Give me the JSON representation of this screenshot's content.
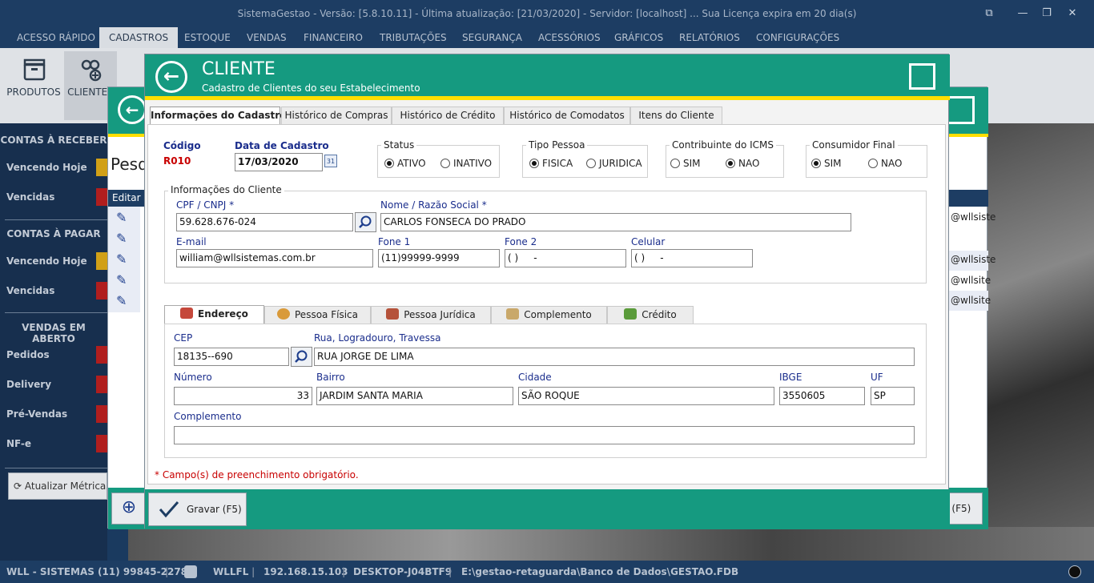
{
  "window": {
    "title": "SistemaGestao - Versão: [5.8.10.11] - Última atualização: [21/03/2020] - Servidor: [localhost] ... Sua Licença expira em 20 dia(s)"
  },
  "menu": [
    "ACESSO RÁPIDO",
    "CADASTROS",
    "ESTOQUE",
    "VENDAS",
    "FINANCEIRO",
    "TRIBUTAÇÕES",
    "SEGURANÇA",
    "ACESSÓRIOS",
    "GRÁFICOS",
    "RELATÓRIOS",
    "CONFIGURAÇÕES"
  ],
  "ribbon": {
    "produtos": "PRODUTOS",
    "clientes": "CLIENTES"
  },
  "sidebar": {
    "contas_receber": "CONTAS À RECEBER",
    "vencendo_hoje_1": "Vencendo Hoje",
    "vencidas_1": "Vencidas",
    "contas_pagar": "CONTAS À PAGAR",
    "vencendo_hoje_2": "Vencendo Hoje",
    "vencidas_2": "Vencidas",
    "vendas_aberto": "VENDAS EM ABERTO",
    "pedidos": "Pedidos",
    "delivery": "Delivery",
    "pre_vendas": "Pré-Vendas",
    "nfe": "NF-e",
    "atualizar": "Atualizar Métricas"
  },
  "behind": {
    "pesq": "Pesq",
    "editar": "Editar",
    "emails": [
      "@wllsiste",
      "@wllsiste",
      "@wllsite",
      "@wllsite"
    ],
    "f5": "r (F5)"
  },
  "dialog": {
    "title": "CLIENTE",
    "subtitle": "Cadastro de Clientes do seu Estabelecimento",
    "tabs": [
      "Informações do Cadastro",
      "Histórico de Compras",
      "Histórico de Crédito",
      "Histórico de Comodatos",
      "Itens do Cliente"
    ],
    "codigo_label": "Código",
    "codigo": "R010",
    "data_label": "Data de Cadastro",
    "data": "17/03/2020",
    "status": {
      "title": "Status",
      "opt1": "ATIVO",
      "opt2": "INATIVO",
      "selected": "ATIVO"
    },
    "tipo": {
      "title": "Tipo Pessoa",
      "opt1": "FISICA",
      "opt2": "JURIDICA",
      "selected": "FISICA"
    },
    "icms": {
      "title": "Contribuinte do ICMS",
      "opt1": "SIM",
      "opt2": "NAO",
      "selected": "NAO"
    },
    "consumidor": {
      "title": "Consumidor Final",
      "opt1": "SIM",
      "opt2": "NAO",
      "selected": "SIM"
    },
    "info_group": "Informações do Cliente",
    "cpf_label": "CPF / CNPJ *",
    "cpf": "59.628.676-024",
    "nome_label": "Nome / Razão Social *",
    "nome": "CARLOS FONSECA DO PRADO",
    "email_label": "E-mail",
    "email": "william@wllsistemas.com.br",
    "fone1_label": "Fone 1",
    "fone1": "(11)99999-9999",
    "fone2_label": "Fone 2",
    "fone2": "( )     -",
    "celular_label": "Celular",
    "celular": "( )     -",
    "subtabs": [
      "Endereço",
      "Pessoa Física",
      "Pessoa Jurídica",
      "Complemento",
      "Crédito"
    ],
    "cep_label": "CEP",
    "cep": "18135--690",
    "rua_label": "Rua, Logradouro, Travessa",
    "rua": "RUA JORGE DE LIMA",
    "numero_label": "Número",
    "numero": "33",
    "bairro_label": "Bairro",
    "bairro": "JARDIM SANTA MARIA",
    "cidade_label": "Cidade",
    "cidade": "SÃO ROQUE",
    "ibge_label": "IBGE",
    "ibge": "3550605",
    "uf_label": "UF",
    "uf": "SP",
    "complemento_label": "Complemento",
    "complemento": "",
    "required_note": "* Campo(s) de preenchimento obrigatório.",
    "gravar": "Gravar (F5)"
  },
  "statusbar": {
    "company": "WLL - SISTEMAS (11) 99845-2278",
    "user": "WLLFL",
    "ip": "192.168.15.103",
    "host": "DESKTOP-J04BTF9",
    "db": "E:\\gestao-retaguarda\\Banco de Dados\\GESTAO.FDB"
  },
  "colors": {
    "teal": "#159a80",
    "yellow": "#ffde00",
    "navy": "#1d3d63",
    "label_navy": "#1a2d8c",
    "required_red": "#c80000"
  }
}
